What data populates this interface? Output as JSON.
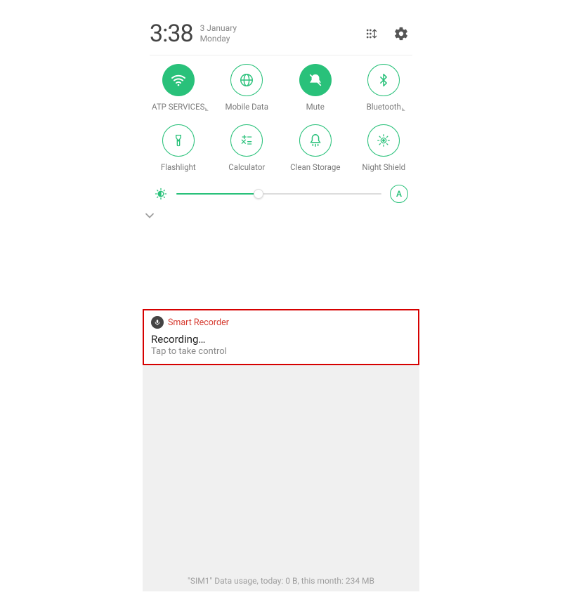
{
  "header": {
    "time": "3:38",
    "date_line1": "3 January",
    "date_line2": "Monday"
  },
  "tiles": {
    "wifi": {
      "label": "ATP SERVICES",
      "active": true,
      "expandable": true
    },
    "mobile_data": {
      "label": "Mobile Data",
      "active": false,
      "expandable": false
    },
    "mute": {
      "label": "Mute",
      "active": true,
      "expandable": false
    },
    "bluetooth": {
      "label": "Bluetooth",
      "active": false,
      "expandable": true
    },
    "flashlight": {
      "label": "Flashlight",
      "active": false,
      "expandable": false
    },
    "calculator": {
      "label": "Calculator",
      "active": false,
      "expandable": false
    },
    "clean": {
      "label": "Clean Storage",
      "active": false,
      "expandable": false
    },
    "night": {
      "label": "Night Shield",
      "active": false,
      "expandable": false
    }
  },
  "brightness": {
    "percent": 40,
    "auto_label": "A"
  },
  "notification": {
    "app": "Smart Recorder",
    "title": "Recording…",
    "subtitle": "Tap to take control"
  },
  "footer": "\"SIM1\" Data usage, today: 0 B, this month: 234 MB",
  "colors": {
    "accent": "#29c17a",
    "highlight_border": "#d60000"
  }
}
